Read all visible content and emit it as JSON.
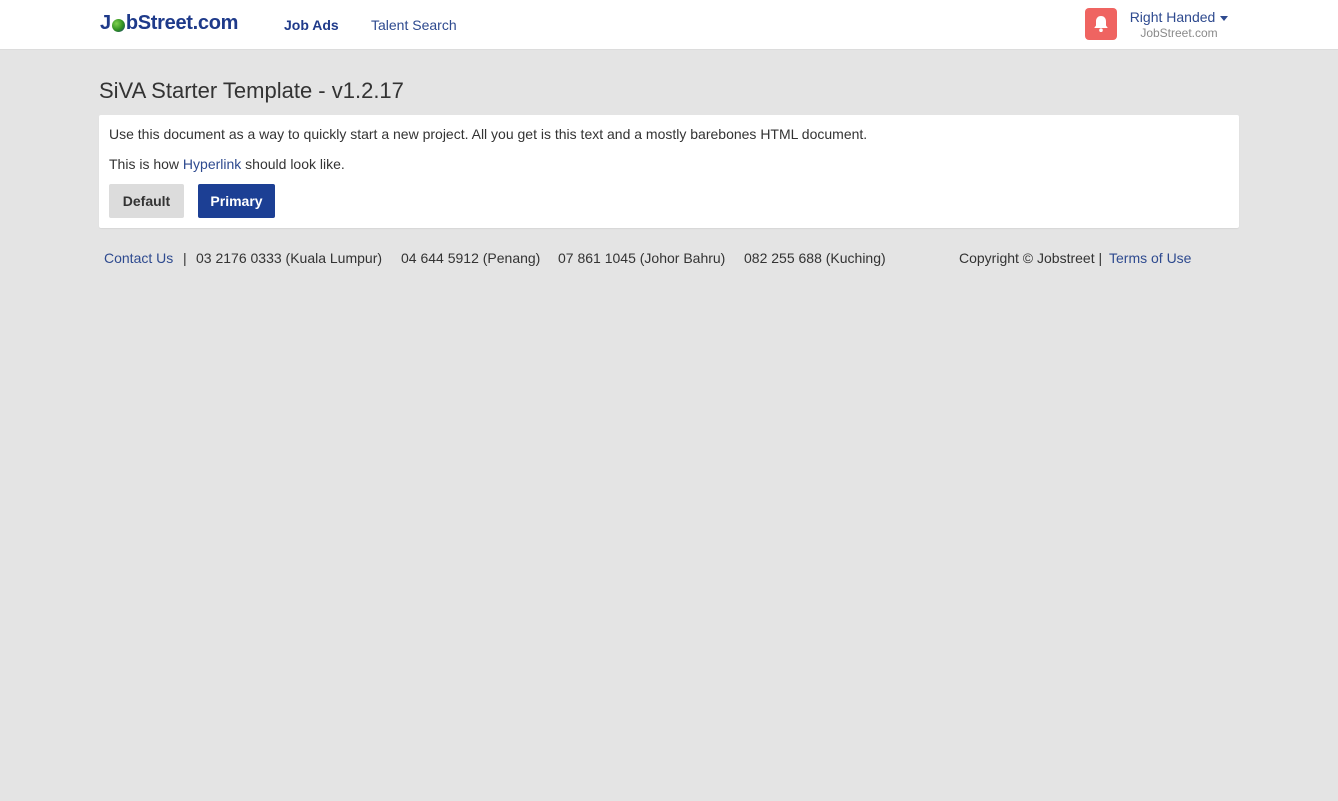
{
  "header": {
    "logo": {
      "prefix": "J",
      "suffix": "bStreet.com"
    },
    "nav": [
      {
        "label": "Job Ads",
        "active": true
      },
      {
        "label": "Talent Search",
        "active": false
      }
    ],
    "notification_icon": "bell-icon",
    "user": {
      "name": "Right Handed",
      "company": "JobStreet.com"
    }
  },
  "main": {
    "title": "SiVA Starter Template - v1.2.17",
    "intro": "Use this document as a way to quickly start a new project. All you get is this text and a mostly barebones HTML document.",
    "link_prefix": "This is how ",
    "link_text": "Hyperlink",
    "link_suffix": " should look like.",
    "buttons": {
      "default_label": "Default",
      "primary_label": "Primary"
    }
  },
  "footer": {
    "contact_label": "Contact Us",
    "separator": "|",
    "phones": [
      "03 2176 0333 (Kuala Lumpur)",
      "04 644 5912 (Penang)",
      "07 861 1045 (Johor Bahru)",
      "082 255 688 (Kuching)"
    ],
    "copyright": "Copyright © Jobstreet |",
    "terms_label": "Terms of Use"
  },
  "colors": {
    "brand_blue": "#1c3f94",
    "link_blue": "#2e4a8f",
    "bell_red": "#ef6461",
    "page_bg": "#e4e4e4"
  }
}
